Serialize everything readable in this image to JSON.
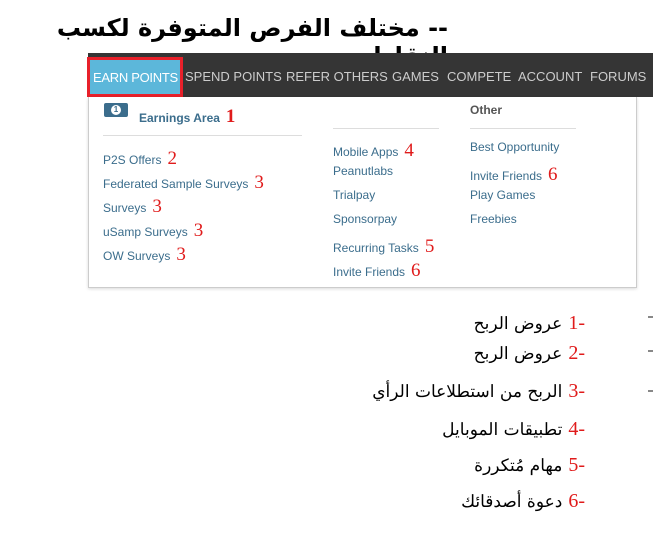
{
  "title": "-- مختلف الفرص المتوفرة لكسب النقاط --",
  "nav": {
    "items": [
      "EARN POINTS",
      "SPEND POINTS",
      "REFER OTHERS",
      "GAMES",
      "COMPETE",
      "ACCOUNT",
      "FORUMS"
    ],
    "active": "EARN POINTS"
  },
  "dropdown": {
    "earnings_header": "Earnings Area",
    "earnings_num": "1",
    "col1": [
      {
        "label": "P2S Offers",
        "num": "2"
      },
      {
        "label": "Federated Sample Surveys",
        "num": "3"
      },
      {
        "label": "Surveys",
        "num": "3"
      },
      {
        "label": "uSamp Surveys",
        "num": "3"
      },
      {
        "label": "OW Surveys",
        "num": "3"
      }
    ],
    "col2": [
      {
        "label": "Mobile Apps",
        "num": "4"
      },
      {
        "label": "Peanutlabs",
        "num": ""
      },
      {
        "label": "Trialpay",
        "num": ""
      },
      {
        "label": "Sponsorpay",
        "num": ""
      },
      {
        "label": "Recurring Tasks",
        "num": "5"
      },
      {
        "label": "Invite Friends",
        "num": "6"
      }
    ],
    "other_header": "Other",
    "col3": [
      {
        "label": "Best Opportunity",
        "num": ""
      },
      {
        "label": "Invite Friends",
        "num": "6"
      },
      {
        "label": "Play Games",
        "num": ""
      },
      {
        "label": "Freebies",
        "num": ""
      }
    ]
  },
  "legend": [
    {
      "n": "1-",
      "t": "عروض الربح"
    },
    {
      "n": "2-",
      "t": "عروض الربح"
    },
    {
      "n": "3-",
      "t": "الربح من استطلاعات الرأي"
    },
    {
      "n": "4-",
      "t": "تطبيقات الموبايل"
    },
    {
      "n": "5-",
      "t": "مهام مُتكررة"
    },
    {
      "n": "6-",
      "t": "دعوة أصدقائك"
    }
  ],
  "colors": {
    "nav_bg": "#353535",
    "active_bg": "#5cb7da",
    "highlight": "#e8202a",
    "link": "#3b6d8c",
    "annotation": "#e01b1b"
  }
}
